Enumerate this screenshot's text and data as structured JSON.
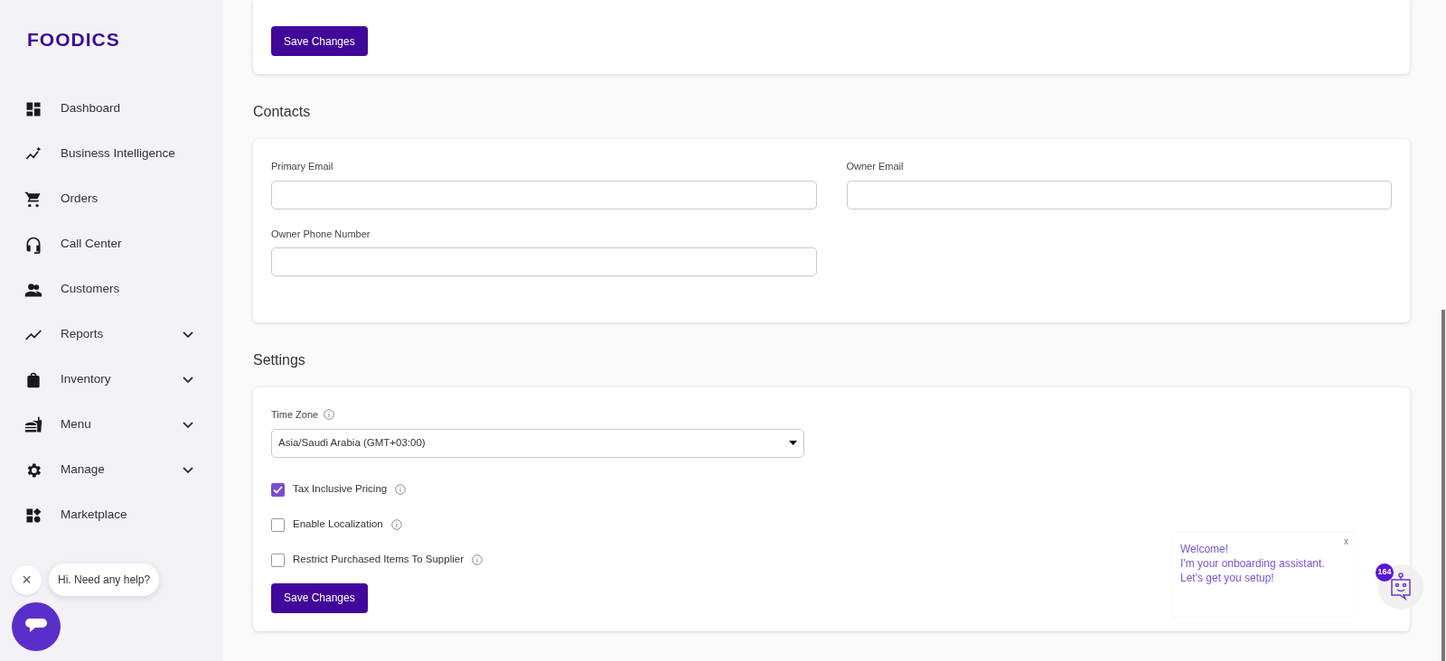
{
  "logo": "FOODICS",
  "sidebar": {
    "items": [
      {
        "label": "Dashboard",
        "kind": "dashboard",
        "expandable": false
      },
      {
        "label": "Business Intelligence",
        "kind": "bi",
        "expandable": false
      },
      {
        "label": "Orders",
        "kind": "cart",
        "expandable": false
      },
      {
        "label": "Call Center",
        "kind": "headset",
        "expandable": false
      },
      {
        "label": "Customers",
        "kind": "people",
        "expandable": false
      },
      {
        "label": "Reports",
        "kind": "trend",
        "expandable": true
      },
      {
        "label": "Inventory",
        "kind": "bag",
        "expandable": true
      },
      {
        "label": "Menu",
        "kind": "food",
        "expandable": true
      },
      {
        "label": "Manage",
        "kind": "gear",
        "expandable": true
      },
      {
        "label": "Marketplace",
        "kind": "apps",
        "expandable": false
      }
    ]
  },
  "top_card": {
    "button": "Save Changes"
  },
  "contacts": {
    "heading": "Contacts",
    "fields": [
      {
        "label": "Primary Email"
      },
      {
        "label": "Owner Email"
      },
      {
        "label": "Owner Phone Number"
      }
    ]
  },
  "settings": {
    "heading": "Settings",
    "time_zone": {
      "label": "Time Zone",
      "value": "Asia/Saudi Arabia (GMT+03:00)"
    },
    "options": [
      {
        "label": "Tax Inclusive Pricing",
        "checked": true
      },
      {
        "label": "Enable Localization",
        "checked": false
      },
      {
        "label": "Restrict Purchased Items To Supplier",
        "checked": false
      }
    ],
    "button": "Save Changes"
  },
  "help_bubble": {
    "close": "×",
    "text": "Hi. Need any help?"
  },
  "assistant": {
    "close": "x",
    "lines": [
      "Welcome!",
      "I'm your onboarding assistant.",
      "Let's get you setup!"
    ],
    "badge": "164"
  }
}
